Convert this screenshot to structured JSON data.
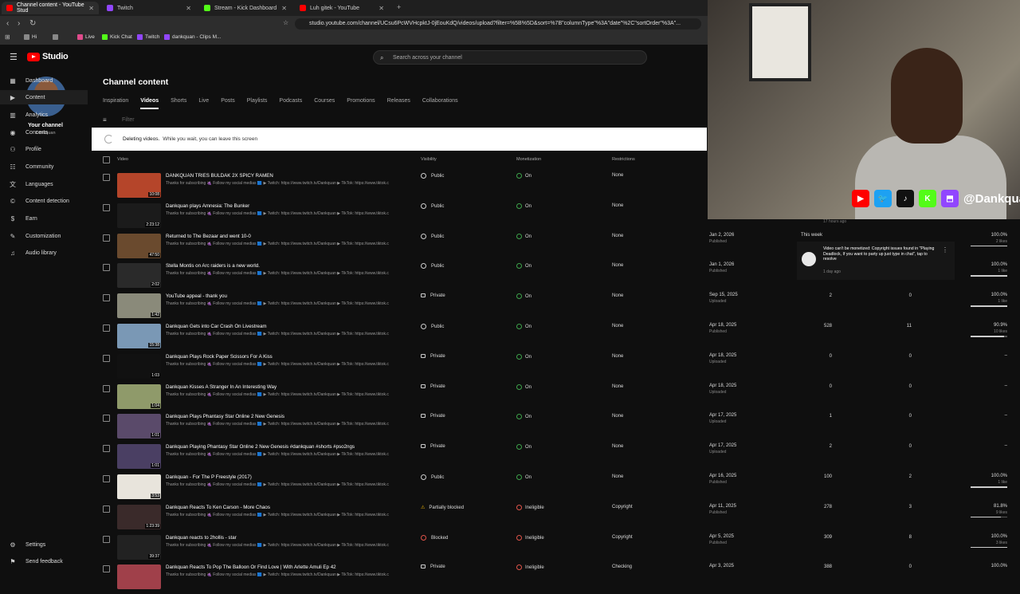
{
  "browser": {
    "tabs": [
      {
        "label": "Channel content - YouTube Stud",
        "color": "#ff0000",
        "active": true
      },
      {
        "label": "Twitch",
        "color": "#9146ff",
        "active": false
      },
      {
        "label": "Stream - Kick Dashboard",
        "color": "#53fc18",
        "active": false
      },
      {
        "label": "Luh gitek - YouTube",
        "color": "#ff0000",
        "active": false
      }
    ],
    "url": "studio.youtube.com/channel/UCsu6PcWVHcpktJ-0jEouKdQ/videos/upload?filter=%5B%5D&sort=%7B\"columnType\"%3A\"date\"%2C\"sortOrder\"%3A\"...",
    "bookmarks": [
      "Hi",
      "",
      "Live",
      "Kick Chat",
      "Twitch",
      "dankquan - Clips M..."
    ]
  },
  "header": {
    "logo_text": "Studio",
    "search_placeholder": "Search across your channel"
  },
  "sidebar": {
    "channel_title": "Your channel",
    "channel_handle": "Dankquan",
    "items": [
      {
        "label": "Dashboard",
        "icon": "dashboard-icon",
        "glyph": "▦"
      },
      {
        "label": "Content",
        "icon": "content-icon",
        "glyph": "▶"
      },
      {
        "label": "Analytics",
        "icon": "analytics-icon",
        "glyph": "▥"
      },
      {
        "label": "Concerts",
        "icon": "concerts-icon",
        "glyph": "◉"
      },
      {
        "label": "Profile",
        "icon": "profile-icon",
        "glyph": "⚇"
      },
      {
        "label": "Community",
        "icon": "community-icon",
        "glyph": "☷"
      },
      {
        "label": "Languages",
        "icon": "languages-icon",
        "glyph": "文"
      },
      {
        "label": "Content detection",
        "icon": "content-detection-icon",
        "glyph": "©"
      },
      {
        "label": "Earn",
        "icon": "earn-icon",
        "glyph": "$"
      },
      {
        "label": "Customization",
        "icon": "customization-icon",
        "glyph": "✎"
      },
      {
        "label": "Audio library",
        "icon": "audio-library-icon",
        "glyph": "♫"
      }
    ],
    "settings_label": "Settings",
    "feedback_label": "Send feedback"
  },
  "main": {
    "title": "Channel content",
    "tabs": [
      "Inspiration",
      "Videos",
      "Shorts",
      "Live",
      "Posts",
      "Playlists",
      "Podcasts",
      "Courses",
      "Promotions",
      "Releases",
      "Collaborations"
    ],
    "selected_tab": "Videos",
    "filter_placeholder": "Filter",
    "banner_bold": "Deleting videos.",
    "banner_text": "While you wait, you can leave this screen",
    "columns": {
      "video": "Video",
      "visibility": "Visibility",
      "monetization": "Monetization",
      "restrictions": "Restrictions"
    }
  },
  "desc_template": "Thanks for subscribing 🍇 Follow my social medias 🟦 ▶ Twitch: https://www.twitch.tv/Dankquan ▶ TikTok: https://www.tiktok.com/@Dankquan ▶ Kick: https://www.kick.com/dankquan ▶ Twitter...",
  "videos": [
    {
      "title": "DANKQUAN TRIES BULDAK 2X SPICY RAMEN",
      "duration": "10:08",
      "thumb": "#b5452a",
      "visibility": "Public",
      "vis_type": "public",
      "monetization": "On",
      "mon_type": "on",
      "restrictions": "None",
      "date": "",
      "date_status": "",
      "views": "",
      "comments": "",
      "likes": "",
      "like_count": "",
      "like_ratio": null
    },
    {
      "title": "Dankquan plays Amnesia: The Bunker",
      "duration": "2:23:12",
      "thumb": "#1b1b1b",
      "visibility": "Public",
      "vis_type": "public",
      "monetization": "On",
      "mon_type": "on",
      "restrictions": "None",
      "date": "",
      "date_status": "",
      "views": "",
      "comments": "",
      "likes": "",
      "like_count": "",
      "like_ratio": null
    },
    {
      "title": "Returned to The Bezaar and went 10-0",
      "duration": "47:50",
      "thumb": "#6a4a2e",
      "visibility": "Public",
      "vis_type": "public",
      "monetization": "On",
      "mon_type": "on",
      "restrictions": "None",
      "date": "Jan 2, 2026",
      "date_status": "Published",
      "views": "",
      "comments": "",
      "likes": "100.0%",
      "like_count": "2 likes",
      "like_ratio": 1.0
    },
    {
      "title": "Stella Montis on Arc raiders is a new world.",
      "duration": "2:02",
      "thumb": "#2a2a2a",
      "visibility": "Public",
      "vis_type": "public",
      "monetization": "On",
      "mon_type": "on",
      "restrictions": "None",
      "date": "Jan 1, 2026",
      "date_status": "Published",
      "views": "",
      "comments": "",
      "likes": "100.0%",
      "like_count": "1 like",
      "like_ratio": 1.0
    },
    {
      "title": "YouTube appeal - thank you",
      "duration": "1:42",
      "thumb": "#8a8a7a",
      "visibility": "Private",
      "vis_type": "private",
      "monetization": "On",
      "mon_type": "on",
      "restrictions": "None",
      "date": "Sep 15, 2025",
      "date_status": "Uploaded",
      "views": "2",
      "comments": "0",
      "likes": "100.0%",
      "like_count": "1 like",
      "like_ratio": 1.0
    },
    {
      "title": "Dankquan Gets into Car Crash On Livestream",
      "duration": "15:38",
      "thumb": "#7a98b5",
      "visibility": "Public",
      "vis_type": "public",
      "monetization": "On",
      "mon_type": "on",
      "restrictions": "None",
      "date": "Apr 18, 2025",
      "date_status": "Published",
      "views": "528",
      "comments": "11",
      "likes": "90.9%",
      "like_count": "10 likes",
      "like_ratio": 0.909
    },
    {
      "title": "Dankquan Plays Rock Paper Scissors For A Kiss",
      "duration": "1:03",
      "thumb": "#111111",
      "visibility": "Private",
      "vis_type": "private",
      "monetization": "On",
      "mon_type": "on",
      "restrictions": "None",
      "date": "Apr 18, 2025",
      "date_status": "Uploaded",
      "views": "0",
      "comments": "0",
      "likes": "–",
      "like_count": "",
      "like_ratio": null
    },
    {
      "title": "Dankquan Kisses A Stranger In An Interesting Way",
      "duration": "1:04",
      "thumb": "#8f9a6a",
      "visibility": "Private",
      "vis_type": "private",
      "monetization": "On",
      "mon_type": "on",
      "restrictions": "None",
      "date": "Apr 18, 2025",
      "date_status": "Uploaded",
      "views": "0",
      "comments": "0",
      "likes": "–",
      "like_count": "",
      "like_ratio": null
    },
    {
      "title": "Dankquan Plays Phantasy Star Online 2 New Genesis",
      "duration": "1:01",
      "thumb": "#5a4a6a",
      "visibility": "Private",
      "vis_type": "private",
      "monetization": "On",
      "mon_type": "on",
      "restrictions": "None",
      "date": "Apr 17, 2025",
      "date_status": "Uploaded",
      "views": "1",
      "comments": "0",
      "likes": "–",
      "like_count": "",
      "like_ratio": null
    },
    {
      "title": "Dankquan Playing Phantasy Star Online 2 New Genesis #dankquan #shorts #pso2ngs",
      "duration": "1:01",
      "thumb": "#4a3f63",
      "visibility": "Private",
      "vis_type": "private",
      "monetization": "On",
      "mon_type": "on",
      "restrictions": "None",
      "date": "Apr 17, 2025",
      "date_status": "Uploaded",
      "views": "2",
      "comments": "0",
      "likes": "–",
      "like_count": "",
      "like_ratio": null
    },
    {
      "title": "Dankquan - For The P Freestyle (2017)",
      "duration": "3:53",
      "thumb": "#e8e4dc",
      "visibility": "Public",
      "vis_type": "public",
      "monetization": "On",
      "mon_type": "on",
      "restrictions": "None",
      "date": "Apr 16, 2025",
      "date_status": "Published",
      "views": "100",
      "comments": "2",
      "likes": "100.0%",
      "like_count": "1 like",
      "like_ratio": 1.0
    },
    {
      "title": "Dankquan Reacts To Ken Carson - More Chaos",
      "duration": "1:23:39",
      "thumb": "#3a2a2a",
      "visibility": "Partially blocked",
      "vis_type": "partial",
      "monetization": "Ineligible",
      "mon_type": "ineligible",
      "restrictions": "Copyright",
      "date": "Apr 11, 2025",
      "date_status": "Published",
      "views": "278",
      "comments": "3",
      "likes": "81.8%",
      "like_count": "9 likes",
      "like_ratio": 0.818
    },
    {
      "title": "Dankquan reacts to 2hollis - star",
      "duration": "39:37",
      "thumb": "#222222",
      "visibility": "Blocked",
      "vis_type": "blocked",
      "monetization": "Ineligible",
      "mon_type": "ineligible",
      "restrictions": "Copyright",
      "date": "Apr 5, 2025",
      "date_status": "Published",
      "views": "309",
      "comments": "8",
      "likes": "100.0%",
      "like_count": "3 likes",
      "like_ratio": 1.0
    },
    {
      "title": "Dankquan Reacts To Pop The Balloon Or Find Love | With Arlette Amuli Ep 42",
      "duration": "",
      "thumb": "#a0404a",
      "visibility": "Private",
      "vis_type": "private",
      "monetization": "Ineligible",
      "mon_type": "ineligible",
      "restrictions": "Checking",
      "date": "Apr 3, 2025",
      "date_status": "",
      "views": "388",
      "comments": "0",
      "likes": "100.0%",
      "like_count": "",
      "like_ratio": null
    }
  ],
  "overlay": {
    "handle": "@Dankquan",
    "social_icons": [
      {
        "name": "youtube-icon",
        "color": "#ff0000",
        "glyph": "▶"
      },
      {
        "name": "twitter-icon",
        "color": "#1da1f2",
        "glyph": "🐦"
      },
      {
        "name": "tiktok-icon",
        "color": "#111111",
        "glyph": "♪"
      },
      {
        "name": "kick-icon",
        "color": "#53fc18",
        "glyph": "K"
      },
      {
        "name": "twitch-icon",
        "color": "#9146ff",
        "glyph": "⬒"
      }
    ]
  },
  "notification": {
    "time_top": "17 hours ago",
    "section": "This week",
    "text": "Video can't be monetized: Copyright issues found in \"Playing Deadlock, If you want to party up just type in chat\", tap to resolve",
    "time": "1 day ago"
  }
}
